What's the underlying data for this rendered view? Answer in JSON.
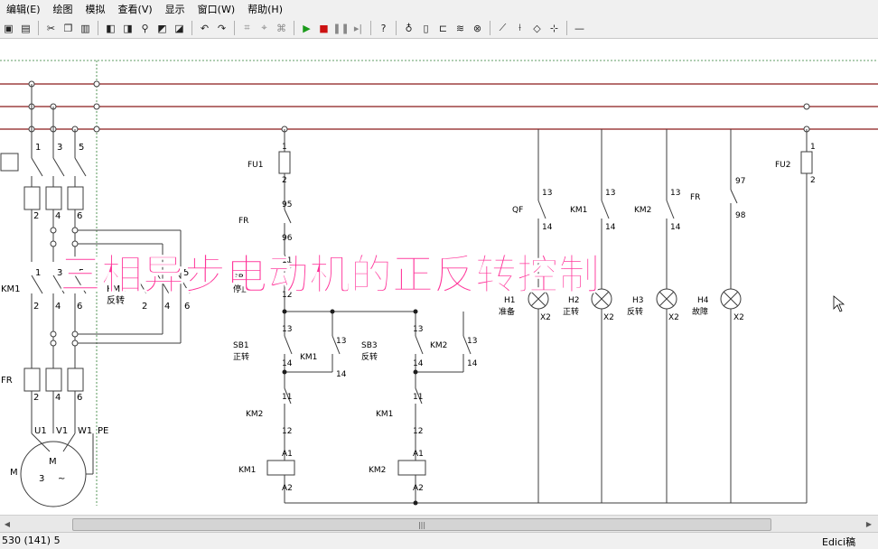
{
  "menu": [
    "编辑(E)",
    "绘图",
    "模拟",
    "查看(V)",
    "显示",
    "窗口(W)",
    "帮助(H)"
  ],
  "toolbar_icons": [
    "print-icon",
    "print-preview-icon",
    "cut-icon",
    "copy-icon",
    "paste-icon",
    "symbol-a-icon",
    "symbol-b-icon",
    "search-icon",
    "symbol-c-icon",
    "symbol-d-icon",
    "undo-icon",
    "redo-icon",
    "tool-a-icon",
    "tool-b-icon",
    "tool-c-icon",
    "run-icon",
    "stop-icon",
    "pause-icon",
    "step-icon",
    "help-icon",
    "pin-icon",
    "contact-icon",
    "coil-icon",
    "spring-icon",
    "lamp-icon",
    "switch-a-icon",
    "switch-b-icon",
    "diamond-icon",
    "junction-icon",
    "line-icon"
  ],
  "overlay": {
    "title": "三相异步电动机的正反转控制",
    "title_color": "#ff3399"
  },
  "diagram": {
    "power": {
      "top_terms": [
        "1",
        "3",
        "5"
      ],
      "fuse_terms": [
        "2",
        "4",
        "6"
      ],
      "km1_label": "KM1",
      "km1_top": [
        "1",
        "3",
        "5"
      ],
      "km1_bottom": [
        "2",
        "4",
        "6"
      ],
      "km2_label": "KM2",
      "km2_sub": "反转",
      "km2_nums": [
        "5",
        "2",
        "4",
        "6"
      ],
      "fr_label": "FR",
      "fr_bottom": [
        "2",
        "4",
        "6"
      ],
      "motor_terms": [
        "U1",
        "V1",
        "W1",
        "PE"
      ],
      "motor_label": "M",
      "motor_inner_m": "M",
      "motor_inner_3": "3"
    },
    "control": {
      "fu1": {
        "label": "FU1",
        "top": "1",
        "bottom": "2"
      },
      "fr": {
        "label": "FR",
        "top": "95",
        "bottom": "96"
      },
      "sb2": {
        "label": "SB2",
        "sub": "停止",
        "top": "11",
        "bottom": "12"
      },
      "branch1": {
        "sb": "SB1",
        "sb_sub": "正转",
        "km": "KM1",
        "top": "13",
        "bottom": "14",
        "il_label": "KM2",
        "il_top": "11",
        "il_bottom": "12",
        "coil": "KM1",
        "a1": "A1",
        "a2": "A2"
      },
      "branch2": {
        "sb": "SB3",
        "sb_sub": "反转",
        "km": "KM2",
        "top": "13",
        "bottom": "14",
        "il_label": "KM1",
        "il_top": "11",
        "il_bottom": "12",
        "coil": "KM2",
        "a1": "A1",
        "a2": "A2"
      }
    },
    "lamps": [
      {
        "contact": "QF",
        "top": "13",
        "bottom": "14",
        "lamp": "H1",
        "sub": "准备",
        "x2": "X2"
      },
      {
        "contact": "KM1",
        "top": "13",
        "bottom": "14",
        "lamp": "H2",
        "sub": "正转",
        "x2": "X2"
      },
      {
        "contact": "KM2",
        "top": "13",
        "bottom": "14",
        "lamp": "H3",
        "sub": "反转",
        "x2": "X2"
      },
      {
        "contact": "FR",
        "top": "97",
        "bottom": "98",
        "lamp": "H4",
        "sub": "故障",
        "x2": "X2"
      }
    ],
    "fu2": {
      "label": "FU2",
      "top": "1",
      "bottom": "2"
    },
    "colors": {
      "bus": "#8b1a1a",
      "wire": "#3c3c3c",
      "terminal": "#1e1e1e"
    }
  },
  "status": {
    "left": "530 (141) 5",
    "right": "Edici稿"
  }
}
